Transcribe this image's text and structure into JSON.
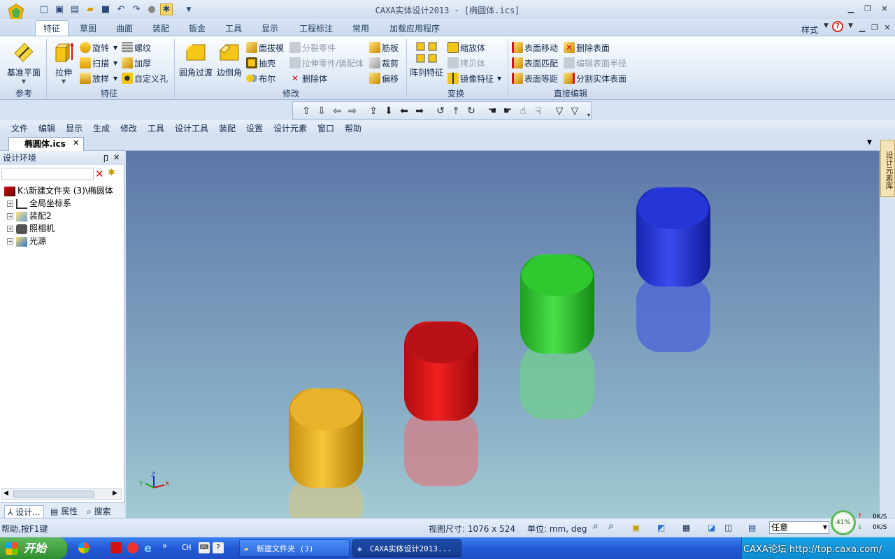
{
  "window": {
    "title": "CAXA实体设计2013 - [椭圆体.ics]",
    "style_label": "样式"
  },
  "ribbon_tabs": [
    "特征",
    "草图",
    "曲面",
    "装配",
    "钣金",
    "工具",
    "显示",
    "工程标注",
    "常用",
    "加载应用程序"
  ],
  "ribbon": {
    "ref": {
      "label": "参考",
      "datum": "基准平面"
    },
    "feature": {
      "label": "特征",
      "extrude": "拉伸",
      "revolve": "旋转",
      "sweep": "扫描",
      "loft": "放样",
      "thread": "螺纹",
      "thicken": "加厚",
      "custom_hole": "自定义孔"
    },
    "modify": {
      "label": "修改",
      "fillet": "圆角过渡",
      "chamfer": "边倒角",
      "draft": "面拔模",
      "shell": "抽壳",
      "boolean": "布尔",
      "split_part": "分裂零件",
      "extrude_part": "拉伸零件/装配体",
      "delete_body": "删除体",
      "rib": "筋板",
      "trim": "裁剪",
      "offset": "偏移"
    },
    "transform": {
      "label": "变换",
      "pattern": "阵列特征",
      "scale": "缩放体",
      "copy": "拷贝体",
      "mirror": "镜像特征"
    },
    "direct": {
      "label": "直接编辑",
      "move_face": "表面移动",
      "match_face": "表面匹配",
      "equidistant": "表面等距",
      "delete_face": "删除表面",
      "edit_radius": "编辑表面半径",
      "split_face": "分割实体表面"
    }
  },
  "menu": [
    "文件",
    "编辑",
    "显示",
    "生成",
    "修改",
    "工具",
    "设计工具",
    "装配",
    "设置",
    "设计元素",
    "窗口",
    "帮助"
  ],
  "doc_tab": "椭圆体.ics",
  "panel": {
    "title": "设计环境",
    "tree": [
      "K:\\新建文件夹 (3)\\椭圆体",
      "全局坐标系",
      "装配2",
      "照相机",
      "光源"
    ],
    "tabs": [
      "设计...",
      "属性",
      "搜索"
    ]
  },
  "side_tab": "设计元素库",
  "status": {
    "help": "帮助,按F1键",
    "view_size": "视图尺寸: 1076 x  524",
    "units": "单位: mm, deg",
    "select_mode": "任意",
    "net_percent": "41%",
    "net_up": "0K/S",
    "net_down": "0K/S"
  },
  "taskbar": {
    "start": "开始",
    "lang": "CH",
    "tasks": [
      "新建文件夹 (3)",
      "CAXA实体设计2013..."
    ],
    "watermark": "CAXA论坛 http://top.caxa.com/"
  },
  "colors": {
    "gold": "#d9a21b",
    "red": "#d4141a",
    "green": "#28c427",
    "blue": "#1d2fd6"
  }
}
